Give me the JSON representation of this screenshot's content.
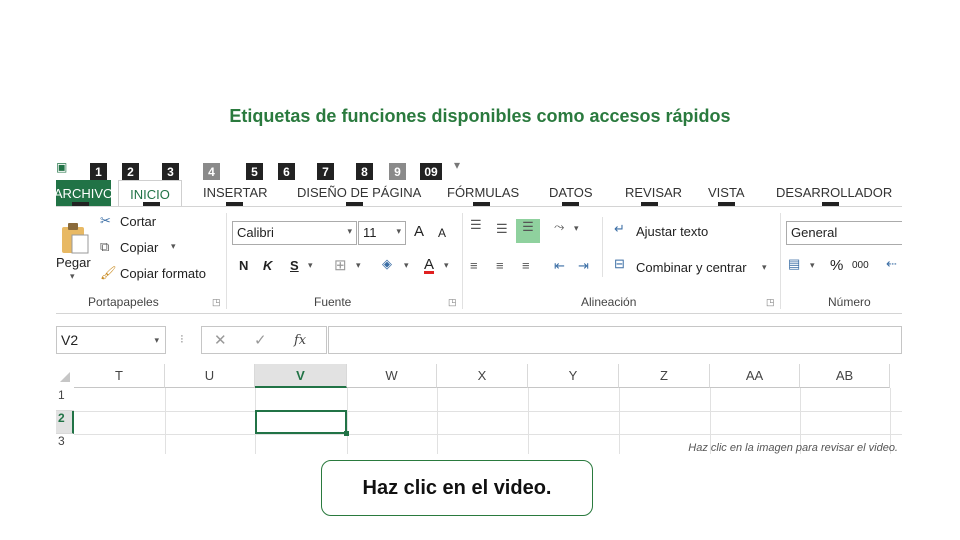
{
  "heading": "Etiquetas de funciones disponibles como accesos rápidos",
  "keytips": {
    "qat": [
      "1",
      "2",
      "3",
      "4",
      "5",
      "6",
      "7",
      "8",
      "9",
      "09"
    ],
    "ribbon": [
      "A",
      "O",
      "B",
      "C",
      "U",
      "D",
      "R",
      "N",
      "G"
    ]
  },
  "tabs": {
    "archivo": "ARCHIVO",
    "inicio": "INICIO",
    "insertar": "INSERTAR",
    "diseno": "DISEÑO DE PÁGINA",
    "formulas": "FÓRMULAS",
    "datos": "DATOS",
    "revisar": "REVISAR",
    "vista": "VISTA",
    "desarrollador": "DESARROLLADOR"
  },
  "clipboard": {
    "paste": "Pegar",
    "cut": "Cortar",
    "copy": "Copiar",
    "format_painter": "Copiar formato",
    "group": "Portapapeles"
  },
  "font": {
    "name": "Calibri",
    "size": "11",
    "bold": "N",
    "italic": "K",
    "underline": "S",
    "grow": "A",
    "shrink": "A",
    "color": "A",
    "group": "Fuente"
  },
  "alignment": {
    "wrap": "Ajustar texto",
    "merge": "Combinar y centrar",
    "group": "Alineación"
  },
  "number": {
    "format": "General",
    "percent": "%",
    "thousands": "000",
    "group": "Número"
  },
  "formula_bar": {
    "namebox": "V2",
    "fx": "fx"
  },
  "grid": {
    "columns": [
      "T",
      "U",
      "V",
      "W",
      "X",
      "Y",
      "Z",
      "AA",
      "AB"
    ],
    "rows": [
      "1",
      "2",
      "3"
    ]
  },
  "hint": "Haz clic en la imagen para revisar el video.",
  "cta": "Haz clic en el video.",
  "colors": {
    "accent_green": "#217346",
    "heading_green": "#2a7a3e",
    "keytip_bg": "#222222"
  }
}
